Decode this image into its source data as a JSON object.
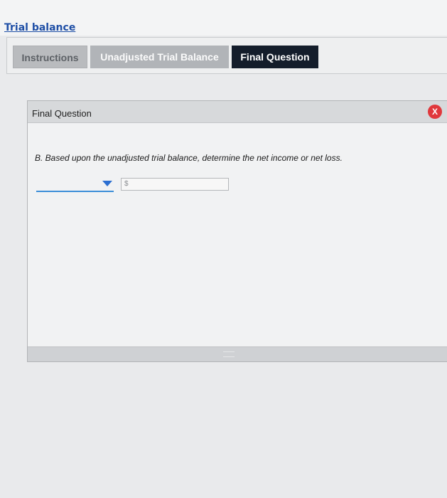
{
  "header": {
    "title": "Trial balance"
  },
  "tabs": [
    {
      "label": "Instructions"
    },
    {
      "label": "Unadjusted Trial Balance"
    },
    {
      "label": "Final Question"
    }
  ],
  "dialog": {
    "title": "Final Question",
    "close_label": "X",
    "question": "B. Based upon the unadjusted trial balance, determine the net income or net loss.",
    "dropdown_value": "",
    "amount_prefix": "$",
    "amount_value": ""
  }
}
